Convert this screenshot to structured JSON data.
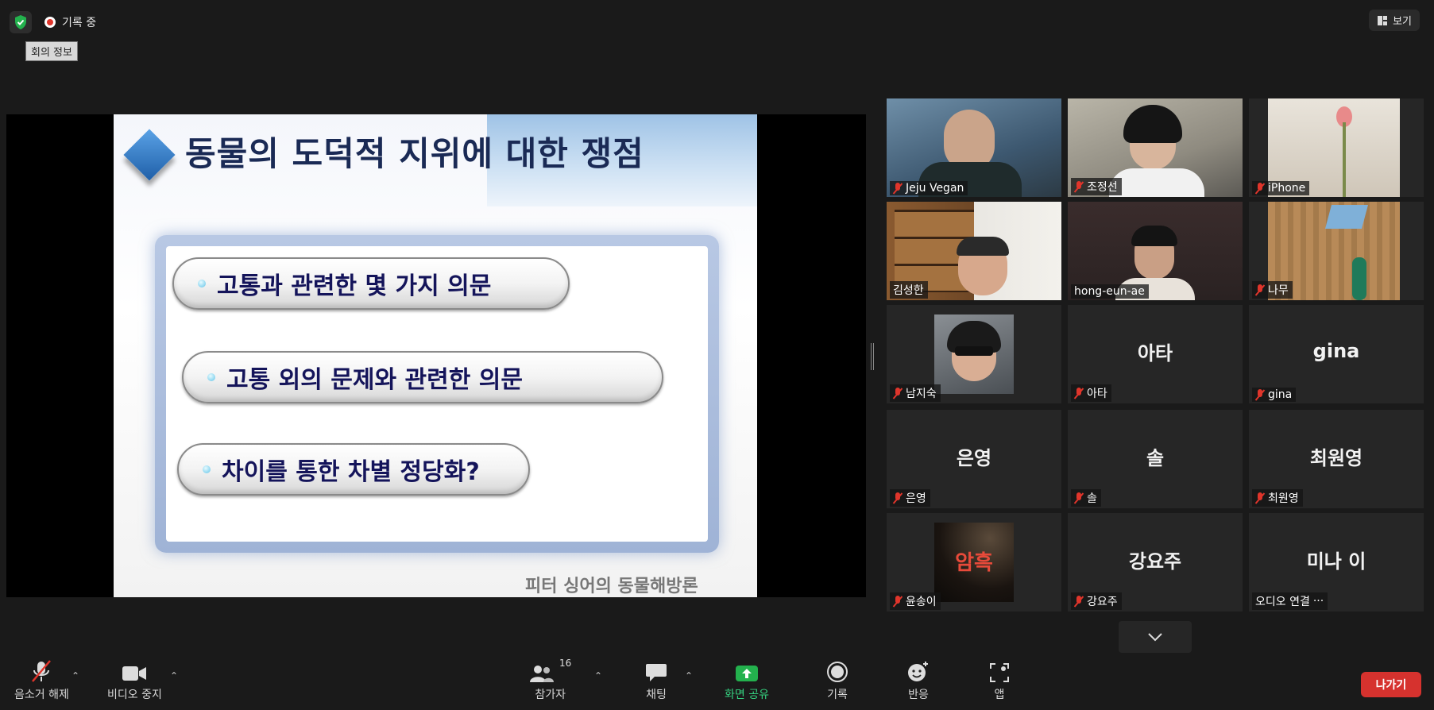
{
  "top_bar": {
    "recording_label": "기록 중",
    "meeting_info_tooltip": "회의 정보",
    "view_label": "보기"
  },
  "slide": {
    "title": "동물의 도덕적 지위에 대한 쟁점",
    "items": [
      "고통과 관련한 몇 가지 의문",
      "고통 외의 문제와 관련한 의문",
      "차이를 통한 차별 정당화?"
    ],
    "footer": "피터 싱어의 동물해방론"
  },
  "participants": [
    {
      "name": "Jeju Vegan",
      "display": "",
      "muted": true,
      "video": true
    },
    {
      "name": "조정선",
      "display": "",
      "muted": true,
      "video": true
    },
    {
      "name": "iPhone",
      "display": "",
      "muted": true,
      "video": true
    },
    {
      "name": "김성한",
      "display": "",
      "muted": false,
      "video": true,
      "active": true
    },
    {
      "name": "hong-eun-ae",
      "display": "",
      "muted": false,
      "video": true
    },
    {
      "name": "나무",
      "display": "",
      "muted": true,
      "video": true
    },
    {
      "name": "남지숙",
      "display": "",
      "muted": true,
      "video": true
    },
    {
      "name": "아타",
      "display": "아타",
      "muted": true,
      "video": false
    },
    {
      "name": "gina",
      "display": "gina",
      "muted": true,
      "video": false
    },
    {
      "name": "은영",
      "display": "은영",
      "muted": true,
      "video": false
    },
    {
      "name": "솔",
      "display": "솔",
      "muted": true,
      "video": false
    },
    {
      "name": "최원영",
      "display": "최원영",
      "muted": true,
      "video": false
    },
    {
      "name": "윤송이",
      "display": "",
      "muted": true,
      "video": true
    },
    {
      "name": "강요주",
      "display": "강요주",
      "muted": true,
      "video": false
    },
    {
      "name": "오디오 연결",
      "display": "미나 이",
      "muted": false,
      "video": false,
      "more": "···"
    }
  ],
  "thumb_text": "암흑",
  "toolbar": {
    "unmute": "음소거 해제",
    "stop_video": "비디오 중지",
    "participants": "참가자",
    "participants_count": "16",
    "chat": "채팅",
    "share_screen": "화면 공유",
    "record": "기록",
    "reactions": "반응",
    "apps": "앱",
    "leave": "나가기"
  },
  "colors": {
    "background": "#1a1a1a",
    "tile": "#262626",
    "active_speaker": "#c6e02b",
    "muted": "#e0352b",
    "share_green": "#35d07f",
    "leave_red": "#d6322e"
  }
}
